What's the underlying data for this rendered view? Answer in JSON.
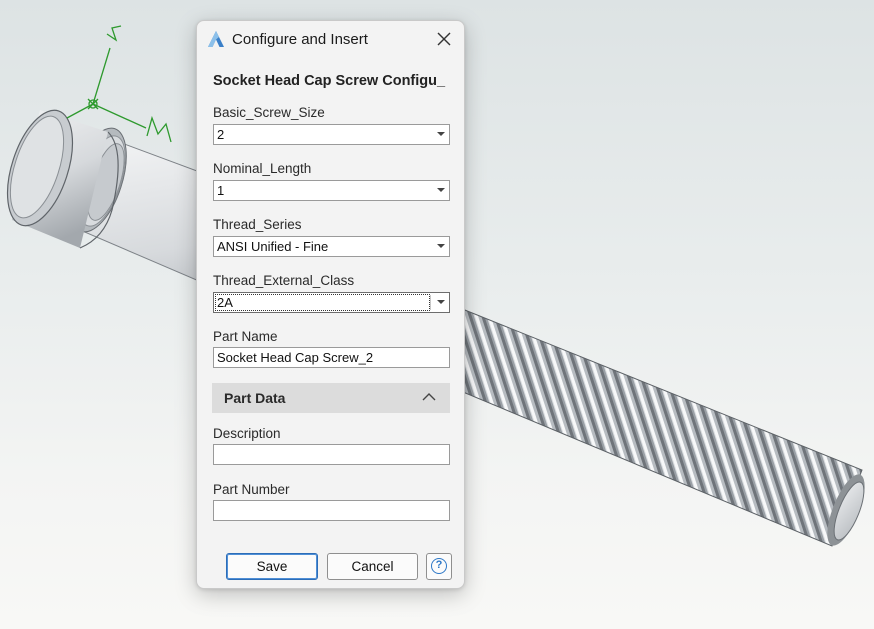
{
  "dialog": {
    "title": "Configure and Insert",
    "app_icon": "app-logo-icon",
    "close_icon": "close-icon",
    "heading": "Socket Head Cap Screw Configu_",
    "fields": {
      "basic_screw_size": {
        "label": "Basic_Screw_Size",
        "value": "2"
      },
      "nominal_length": {
        "label": "Nominal_Length",
        "value": "1"
      },
      "thread_series": {
        "label": "Thread_Series",
        "value": "ANSI Unified - Fine"
      },
      "thread_external_class": {
        "label": "Thread_External_Class",
        "value": "2A"
      },
      "part_name": {
        "label": "Part Name",
        "value": "Socket Head Cap Screw_2"
      }
    },
    "part_data": {
      "label": "Part Data",
      "expanded": true,
      "chevron_icon": "chevron-up-icon",
      "description": {
        "label": "Description",
        "value": ""
      },
      "part_number": {
        "label": "Part Number",
        "value": ""
      }
    },
    "buttons": {
      "save": "Save",
      "cancel": "Cancel",
      "help_glyph": "?",
      "help_icon": "help-icon"
    }
  },
  "viewport": {
    "model": "socket-head-cap-screw",
    "triad_icon": "coordinate-triad-icon",
    "accent_color": "#2e9a2e"
  }
}
